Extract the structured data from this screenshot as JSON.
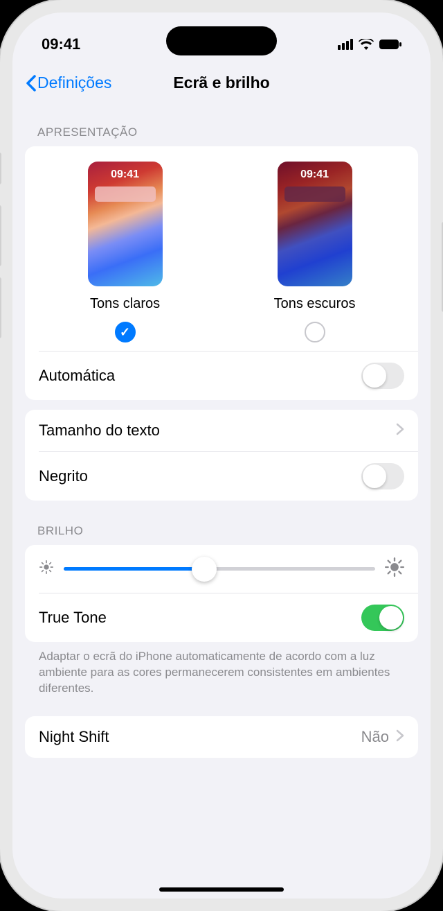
{
  "status": {
    "time": "09:41"
  },
  "nav": {
    "back": "Definições",
    "title": "Ecrã e brilho"
  },
  "sections": {
    "appearance_header": "Apresentação",
    "light_label": "Tons claros",
    "dark_label": "Tons escuros",
    "preview_time": "09:41",
    "automatic": "Automática",
    "text_size": "Tamanho do texto",
    "bold": "Negrito",
    "brightness_header": "Brilho",
    "true_tone": "True Tone",
    "true_tone_desc": "Adaptar o ecrã do iPhone automaticamente de acordo com a luz ambiente para as cores permanecerem consistentes em ambientes diferentes.",
    "night_shift": "Night Shift",
    "night_shift_value": "Não"
  },
  "state": {
    "selected_appearance": "light",
    "automatic_on": false,
    "bold_on": false,
    "brightness_percent": 45,
    "true_tone_on": true
  }
}
